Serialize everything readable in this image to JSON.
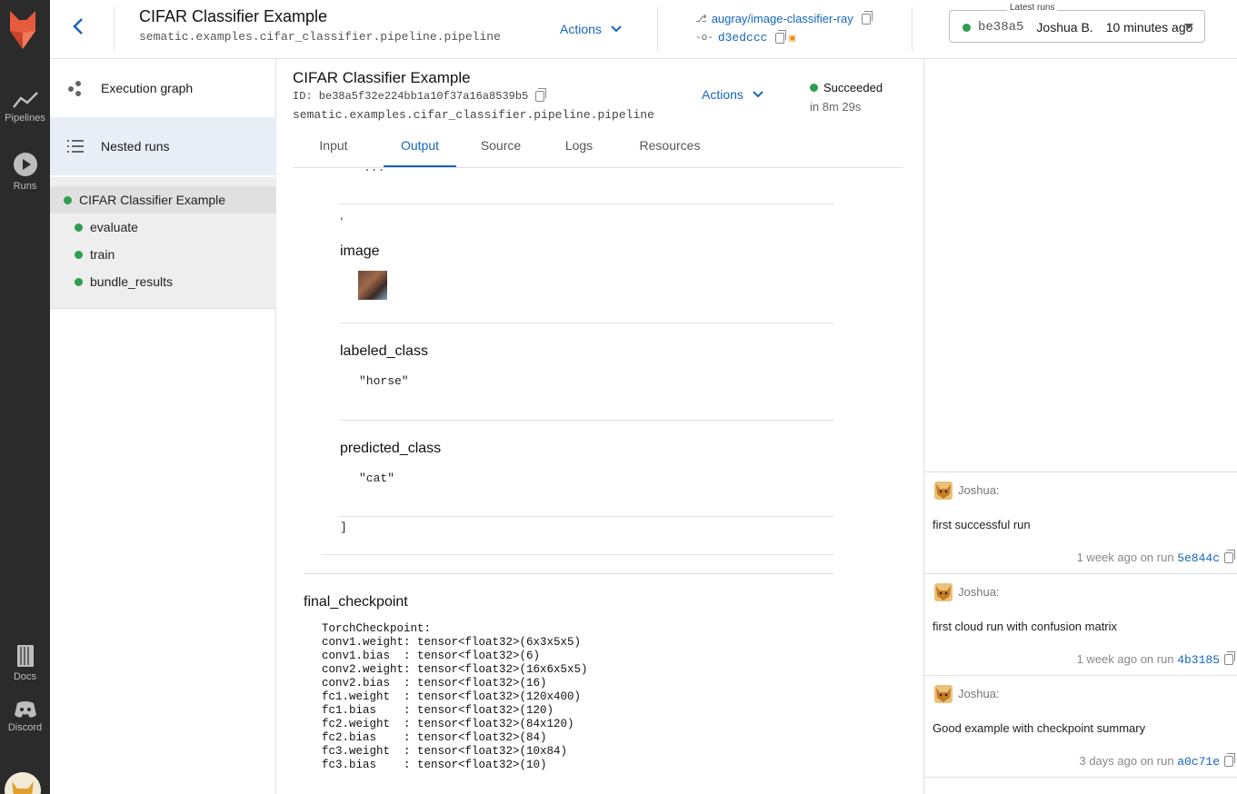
{
  "nav": {
    "pipelines_label": "Pipelines",
    "runs_label": "Runs",
    "docs_label": "Docs",
    "discord_label": "Discord"
  },
  "header": {
    "title": "CIFAR Classifier Example",
    "subtitle": "sematic.examples.cifar_classifier.pipeline.pipeline",
    "actions_label": "Actions",
    "branch": "augray/image-classifier-ray",
    "commit": "d3edccc",
    "latest_runs_legend": "Latest runs",
    "latest_run_id": "be38a5",
    "latest_run_user": "Joshua B.",
    "latest_run_time": "10 minutes ago"
  },
  "sidebar": {
    "execution_graph": "Execution graph",
    "nested_runs": "Nested runs",
    "tree": [
      "CIFAR Classifier Example",
      "evaluate",
      "train",
      "bundle_results"
    ]
  },
  "run": {
    "title": "CIFAR Classifier Example",
    "id": "ID: be38a5f32e224bb1a10f37a16a8539b5",
    "function_path": "sematic.examples.cifar_classifier.pipeline.pipeline",
    "actions_label": "Actions",
    "status": "Succeeded",
    "duration": "in 8m 29s",
    "tabs": [
      "Input",
      "Output",
      "Source",
      "Logs",
      "Resources"
    ]
  },
  "output": {
    "top_fragment": "...",
    "comma": ",",
    "image_label": "image",
    "labeled_class_label": "labeled_class",
    "labeled_class_value": "\"horse\"",
    "predicted_class_label": "predicted_class",
    "predicted_class_value": "\"cat\"",
    "close_bracket": "]",
    "final_checkpoint_label": "final_checkpoint",
    "checkpoint_text": "TorchCheckpoint:\nconv1.weight: tensor<float32>(6x3x5x5)\nconv1.bias  : tensor<float32>(6)\nconv2.weight: tensor<float32>(16x6x5x5)\nconv2.bias  : tensor<float32>(16)\nfc1.weight  : tensor<float32>(120x400)\nfc1.bias    : tensor<float32>(120)\nfc2.weight  : tensor<float32>(84x120)\nfc2.bias    : tensor<float32>(84)\nfc3.weight  : tensor<float32>(10x84)\nfc3.bias    : tensor<float32>(10)"
  },
  "notes": [
    {
      "author": "Joshua:",
      "body": "first successful run",
      "meta": "1 week ago on run",
      "run": "5e844c"
    },
    {
      "author": "Joshua:",
      "body": "first cloud run with confusion matrix",
      "meta": "1 week ago on run",
      "run": "4b3185"
    },
    {
      "author": "Joshua:",
      "body": "Good example with checkpoint summary",
      "meta": "3 days ago on run",
      "run": "a0c71e"
    }
  ]
}
